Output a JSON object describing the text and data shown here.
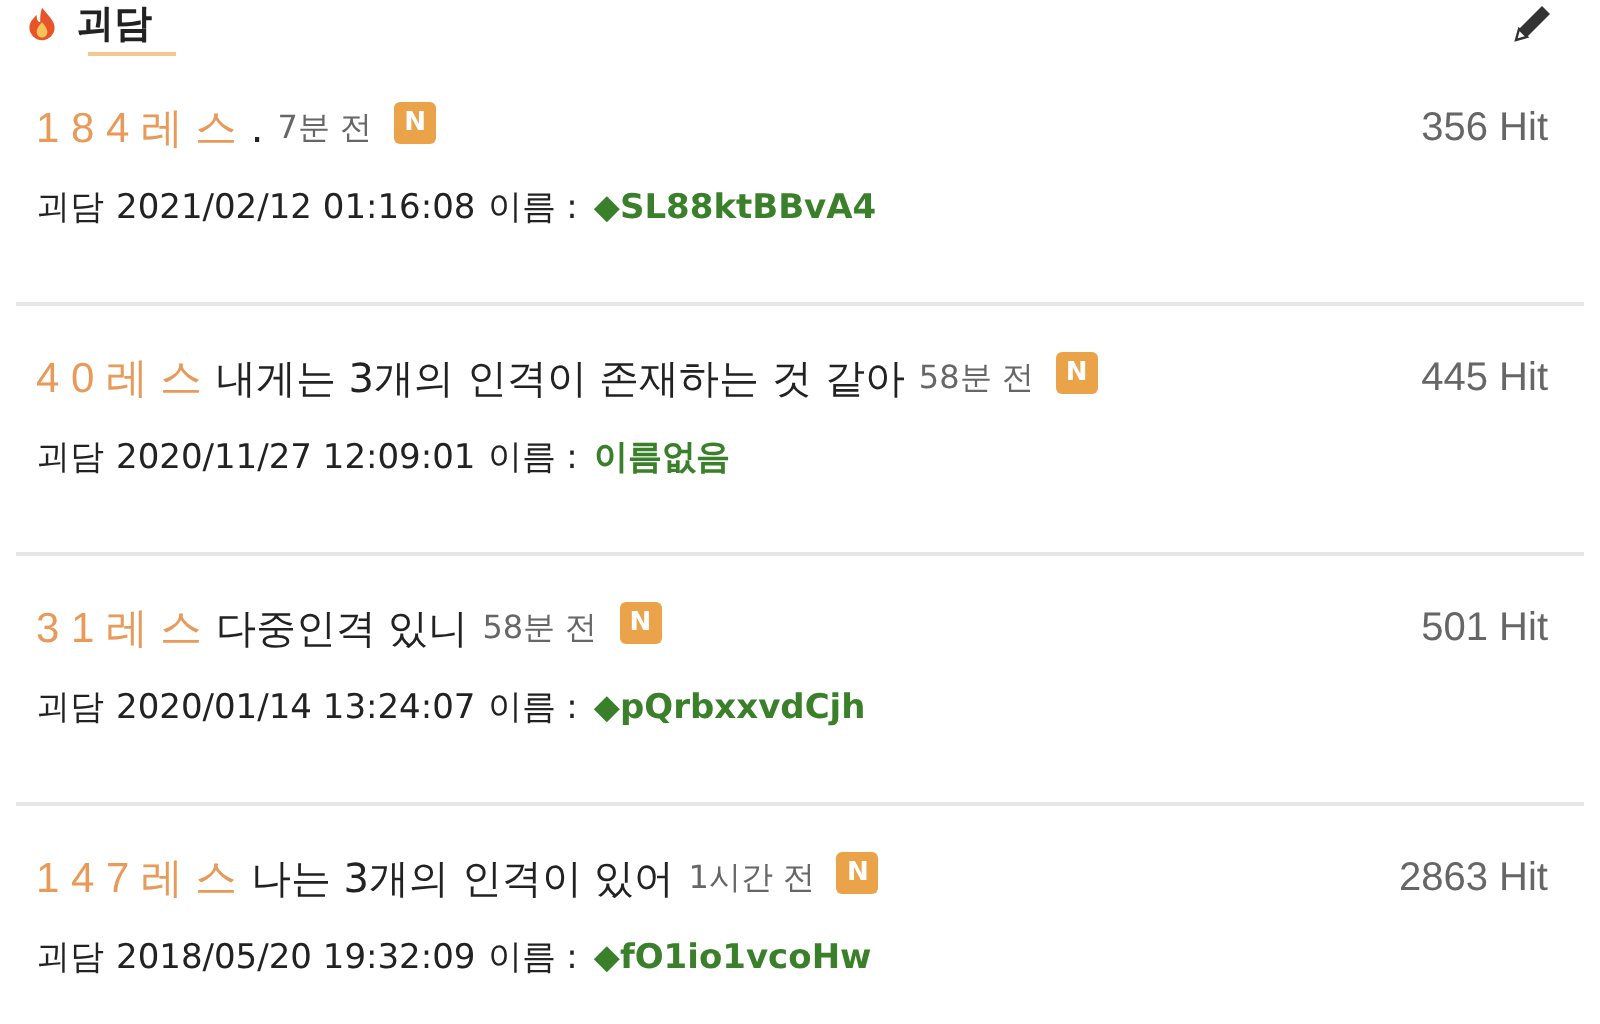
{
  "header": {
    "title": "괴담"
  },
  "threads": [
    {
      "count": "1 8 4 레 스",
      "title": ".",
      "time": "7분 전",
      "badge": "N",
      "hits": "356 Hit",
      "board": "괴담",
      "date": "2021/02/12 01:16:08",
      "name_label": "이름 :",
      "name": "◆SL88ktBBvA4"
    },
    {
      "count": "4 0 레 스",
      "title": "내게는 3개의 인격이 존재하는 것 같아",
      "time": "58분 전",
      "badge": "N",
      "hits": "445 Hit",
      "board": "괴담",
      "date": "2020/11/27 12:09:01",
      "name_label": "이름 :",
      "name": "이름없음"
    },
    {
      "count": "3 1 레 스",
      "title": "다중인격 있니",
      "time": "58분 전",
      "badge": "N",
      "hits": "501 Hit",
      "board": "괴담",
      "date": "2020/01/14 13:24:07",
      "name_label": "이름 :",
      "name": "◆pQrbxxvdCjh"
    },
    {
      "count": "1 4 7 레 스",
      "title": "나는 3개의 인격이 있어",
      "time": "1시간 전",
      "badge": "N",
      "hits": "2863 Hit",
      "board": "괴담",
      "date": "2018/05/20 19:32:09",
      "name_label": "이름 :",
      "name": "◆fO1io1vcoHw"
    }
  ]
}
